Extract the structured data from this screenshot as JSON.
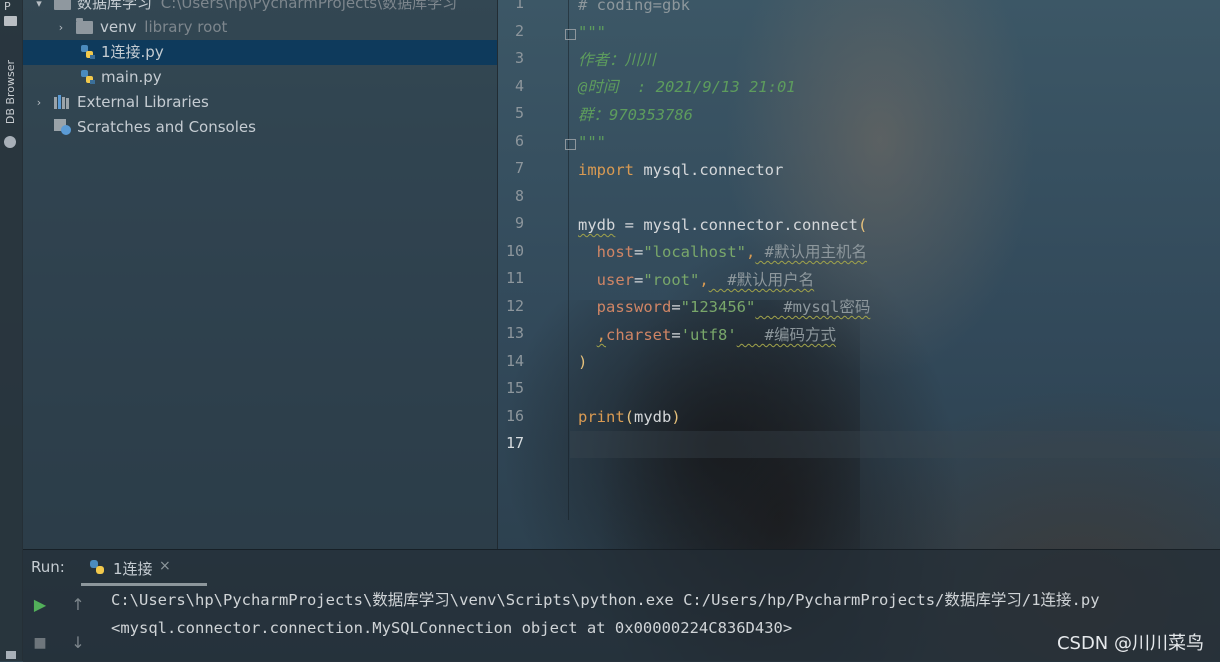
{
  "tool_strip": {
    "project_label": "P",
    "db_browser_label": "DB Browser"
  },
  "project_tree": {
    "root": {
      "name": "数据库学习",
      "path": "C:\\Users\\hp\\PycharmProjects\\数据库学习"
    },
    "items": [
      {
        "name": "venv",
        "sub": "library root",
        "type": "folder"
      },
      {
        "name": "1连接.py",
        "type": "python-file",
        "selected": true
      },
      {
        "name": "main.py",
        "type": "python-file"
      },
      {
        "name": "External Libraries",
        "type": "libraries"
      },
      {
        "name": "Scratches and Consoles",
        "type": "scratches"
      }
    ]
  },
  "editor": {
    "line_numbers": [
      "1",
      "2",
      "3",
      "4",
      "5",
      "6",
      "7",
      "8",
      "9",
      "10",
      "11",
      "12",
      "13",
      "14",
      "15",
      "16",
      "17"
    ],
    "current_line": "17",
    "lines": {
      "l1": "# coding=gbk",
      "l2": "\"\"\"",
      "l3": "作者：川川",
      "l4": "@时间  : 2021/9/13 21:01",
      "l5": "群：970353786",
      "l6": "\"\"\"",
      "l7_kw": "import",
      "l7_rest": " mysql.connector",
      "l9_var": "mydb",
      "l9_mid": " = mysql.connector.connect",
      "l9_paren": "(",
      "l10_param": "host",
      "l10_eq": "=",
      "l10_str": "\"localhost\"",
      "l10_comma": ",",
      "l10_comment": " #默认用主机名",
      "l11_param": "user",
      "l11_eq": "=",
      "l11_str": "\"root\"",
      "l11_comma": ",",
      "l11_comment": "  #默认用户名",
      "l12_param": "password",
      "l12_eq": "=",
      "l12_str": "\"123456\"",
      "l12_comment": "   #mysql密码",
      "l13_comma": ",",
      "l13_param": "charset",
      "l13_eq": "=",
      "l13_str": "'utf8'",
      "l13_comment": "   #编码方式",
      "l14": ")",
      "l16_fn": "print",
      "l16_open": "(",
      "l16_arg": "mydb",
      "l16_close": ")"
    }
  },
  "run": {
    "title": "Run:",
    "tab_label": "1连接",
    "tab_close": "×",
    "output": [
      "C:\\Users\\hp\\PycharmProjects\\数据库学习\\venv\\Scripts\\python.exe C:/Users/hp/PycharmProjects/数据库学习/1连接.py",
      "<mysql.connector.connection.MySQLConnection object at 0x00000224C836D430>"
    ]
  },
  "watermark": "CSDN @川川菜鸟",
  "colors": {
    "selection": "#0e3a5c",
    "keyword": "#d99a52",
    "string": "#79a76a",
    "docstring": "#5d9c5d",
    "run_green": "#52b05a"
  }
}
